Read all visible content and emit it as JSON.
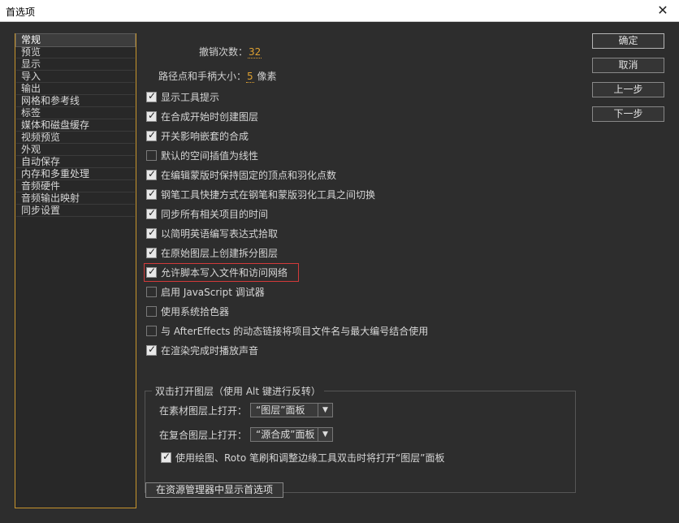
{
  "window": {
    "title": "首选项"
  },
  "sidebar": {
    "items": [
      "常规",
      "预览",
      "显示",
      "导入",
      "输出",
      "网格和参考线",
      "标签",
      "媒体和磁盘缓存",
      "视频预览",
      "外观",
      "自动保存",
      "内存和多重处理",
      "音频硬件",
      "音频输出映射",
      "同步设置"
    ],
    "selected": 0
  },
  "general": {
    "undo_label": "撤销次数：",
    "undo_value": "32",
    "path_label": "路径点和手柄大小：",
    "path_value": "5",
    "path_unit": "像素",
    "options": [
      {
        "label": "显示工具提示",
        "checked": true
      },
      {
        "label": "在合成开始时创建图层",
        "checked": true
      },
      {
        "label": "开关影响嵌套的合成",
        "checked": true
      },
      {
        "label": "默认的空间插值为线性",
        "checked": false
      },
      {
        "label": "在编辑蒙版时保持固定的顶点和羽化点数",
        "checked": true
      },
      {
        "label": "钢笔工具快捷方式在钢笔和蒙版羽化工具之间切换",
        "checked": true
      },
      {
        "label": "同步所有相关项目的时间",
        "checked": true
      },
      {
        "label": "以简明英语编写表达式拾取",
        "checked": true
      },
      {
        "label": "在原始图层上创建拆分图层",
        "checked": true
      },
      {
        "label": "允许脚本写入文件和访问网络",
        "checked": true
      },
      {
        "label": "启用 JavaScript 调试器",
        "checked": false
      },
      {
        "label": "使用系统拾色器",
        "checked": false
      },
      {
        "label": "与 AfterEffects 的动态链接将项目文件名与最大编号结合使用",
        "checked": false
      },
      {
        "label": "在渲染完成时播放声音",
        "checked": true
      }
    ]
  },
  "doubleclick": {
    "legend": "双击打开图层（使用 Alt 键进行反转）",
    "footage_label": "在素材图层上打开：",
    "footage_value": "“图层”面板",
    "comp_label": "在复合图层上打开：",
    "comp_value": "“源合成”面板",
    "paint_label": "使用绘图、Roto 笔刷和调整边缘工具双击时将打开“图层”面板",
    "paint_checked": true
  },
  "buttons": {
    "ok": "确定",
    "cancel": "取消",
    "prev": "上一步",
    "next": "下一步",
    "reveal": "在资源管理器中显示首选项"
  }
}
